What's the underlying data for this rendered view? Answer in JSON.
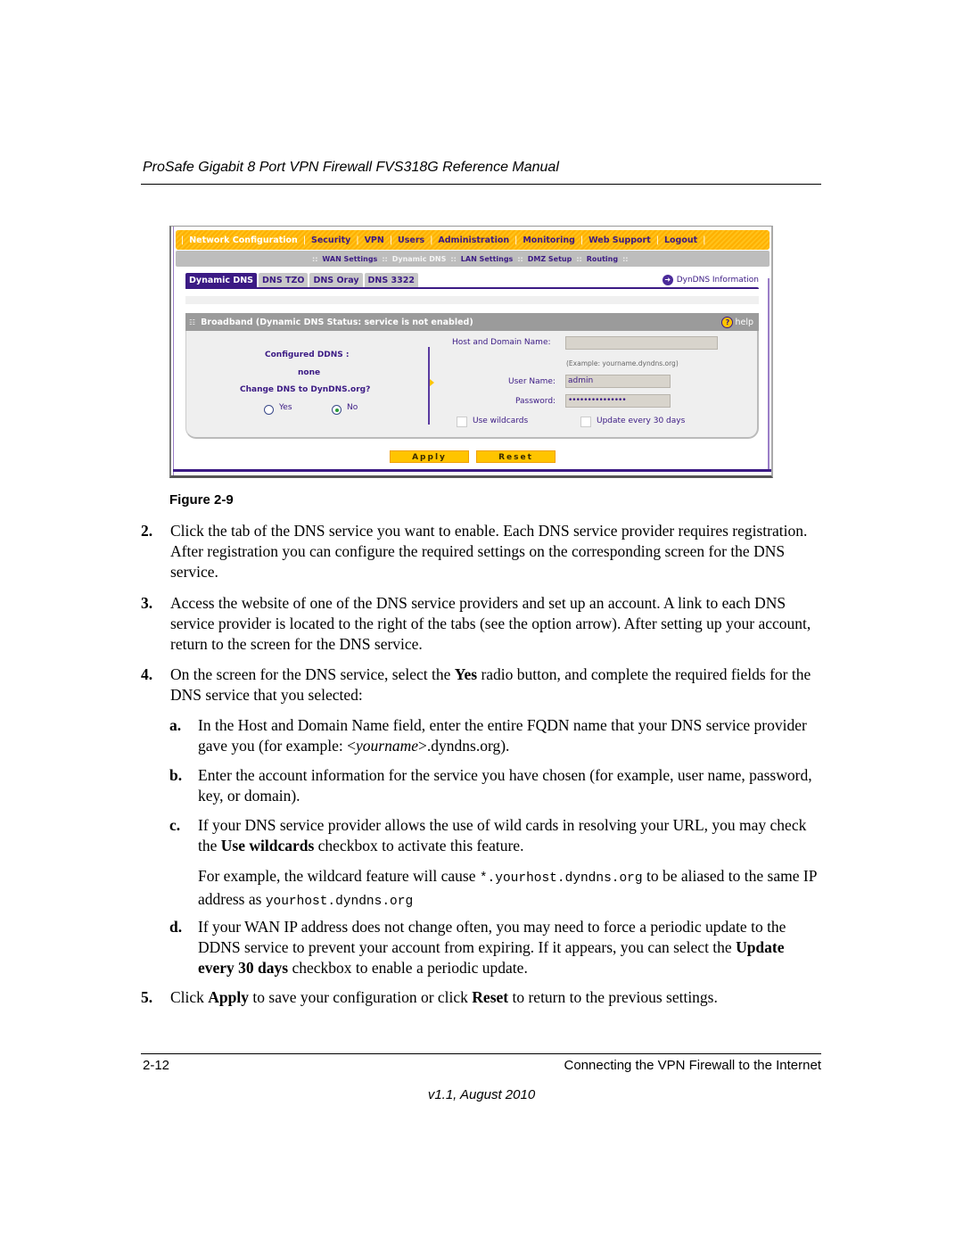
{
  "header": {
    "title": "ProSafe Gigabit 8 Port VPN Firewall FVS318G Reference Manual"
  },
  "screenshot": {
    "top_nav": [
      {
        "label": "Network Configuration",
        "active": true
      },
      {
        "label": "Security",
        "active": false
      },
      {
        "label": "VPN",
        "active": false
      },
      {
        "label": "Users",
        "active": false
      },
      {
        "label": "Administration",
        "active": false
      },
      {
        "label": "Monitoring",
        "active": false
      },
      {
        "label": "Web Support",
        "active": false
      },
      {
        "label": "Logout",
        "active": false
      }
    ],
    "sub_nav": [
      {
        "label": "WAN Settings",
        "active": false
      },
      {
        "label": "Dynamic DNS",
        "active": true
      },
      {
        "label": "LAN Settings",
        "active": false
      },
      {
        "label": "DMZ Setup",
        "active": false
      },
      {
        "label": "Routing",
        "active": false
      }
    ],
    "tabs": [
      {
        "label": "Dynamic DNS",
        "active": true
      },
      {
        "label": "DNS TZO",
        "active": false
      },
      {
        "label": "DNS Oray",
        "active": false
      },
      {
        "label": "DNS 3322",
        "active": false
      }
    ],
    "dyndns_link": "DynDNS Information",
    "panel_title": "Broadband (Dynamic DNS Status: service is not enabled)",
    "help_label": "help",
    "configured_ddns_label": "Configured DDNS :",
    "configured_ddns_value": "none",
    "change_dns_label": "Change DNS to DynDNS.org?",
    "radio_yes": "Yes",
    "radio_no": "No",
    "radio_selected": "No",
    "host_label": "Host and Domain Name:",
    "host_value": "",
    "host_example": "(Example: yourname.dyndns.org)",
    "user_label": "User Name:",
    "user_value": "admin",
    "password_label": "Password:",
    "password_value": "•••••••••••••••",
    "wildcards_label": "Use wildcards",
    "wildcards_checked": false,
    "update_label": "Update every 30 days",
    "update_checked": false,
    "apply_label": "Apply",
    "reset_label": "Reset"
  },
  "caption": "Figure 2-9",
  "steps": {
    "s2_num": "2.",
    "s2_text": "Click the tab of the DNS service you want to enable. Each DNS service provider requires registration. After registration you can configure the required settings on the corresponding screen for the DNS service.",
    "s3_num": "3.",
    "s3_text": "Access the website of one of the DNS service providers and set up an account. A link to each DNS service provider is located to the right of the tabs (see the option arrow). After setting up your account, return to the screen for the DNS service.",
    "s4_num": "4.",
    "s4_pre": "On the screen for the DNS service, select the ",
    "s4_bold": "Yes",
    "s4_post": " radio button, and complete the required fields for the DNS service that you selected:",
    "a_num": "a.",
    "a_pre": "In the Host and Domain Name field, enter the entire FQDN name that your DNS service provider gave you (for example: <",
    "a_italic": "yourname",
    "a_post": ">.dyndns.org).",
    "b_num": "b.",
    "b_text": "Enter the account information for the service you have chosen (for example, user name, password, key, or domain).",
    "c_num": "c.",
    "c_pre": "If your DNS service provider allows the use of wild cards in resolving your URL, you may check the ",
    "c_bold": "Use wildcards",
    "c_post": " checkbox to activate this feature.",
    "c2_pre": "For example, the wildcard feature will cause ",
    "c2_code1": "*.yourhost.dyndns.org",
    "c2_mid": " to be aliased to the same IP address as ",
    "c2_code2": "yourhost.dyndns.org",
    "d_num": "d.",
    "d_pre": "If your WAN IP address does not change often, you may need to force a periodic update to the DDNS service to prevent your account from expiring. If it appears, you can select the ",
    "d_bold": "Update every 30 days",
    "d_post": " checkbox to enable a periodic update.",
    "s5_num": "5.",
    "s5_a": "Click ",
    "s5_b1": "Apply",
    "s5_m": " to save your configuration or click ",
    "s5_b2": "Reset",
    "s5_e": " to return to the previous settings."
  },
  "footer": {
    "page": "2-12",
    "chapter": "Connecting the VPN Firewall to the Internet",
    "version": "v1.1, August 2010"
  }
}
